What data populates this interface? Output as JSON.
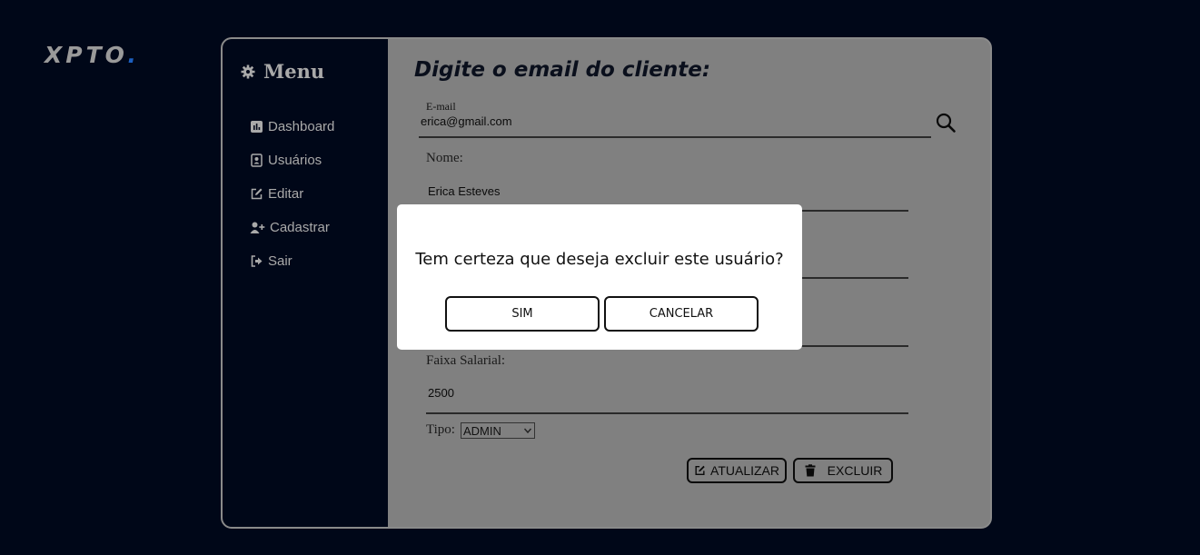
{
  "brand": {
    "name": "XPTO",
    "dot": "."
  },
  "sidebar": {
    "title": "Menu",
    "items": [
      {
        "label": "Dashboard",
        "icon": "chart-icon"
      },
      {
        "label": "Usuários",
        "icon": "contact-icon"
      },
      {
        "label": "Editar",
        "icon": "edit-icon"
      },
      {
        "label": "Cadastrar",
        "icon": "user-plus-icon"
      },
      {
        "label": "Sair",
        "icon": "logout-icon"
      }
    ]
  },
  "form": {
    "heading": "Digite o email do cliente:",
    "email_label": "E-mail",
    "email_value": "erica@gmail.com",
    "nome_label": "Nome:",
    "nome_value": "Erica Esteves",
    "salario_label": "Faixa Salarial:",
    "salario_value": "2500",
    "tipo_label": "Tipo:",
    "tipo_value": "ADMIN",
    "update_label": "ATUALIZAR",
    "delete_label": "EXCLUIR"
  },
  "modal": {
    "message": "Tem certeza que deseja excluir este usuário?",
    "confirm_label": "SIM",
    "cancel_label": "CANCELAR"
  },
  "colors": {
    "background": "#000718",
    "panel": "#808080",
    "accent_dot": "#1c5fbf"
  }
}
